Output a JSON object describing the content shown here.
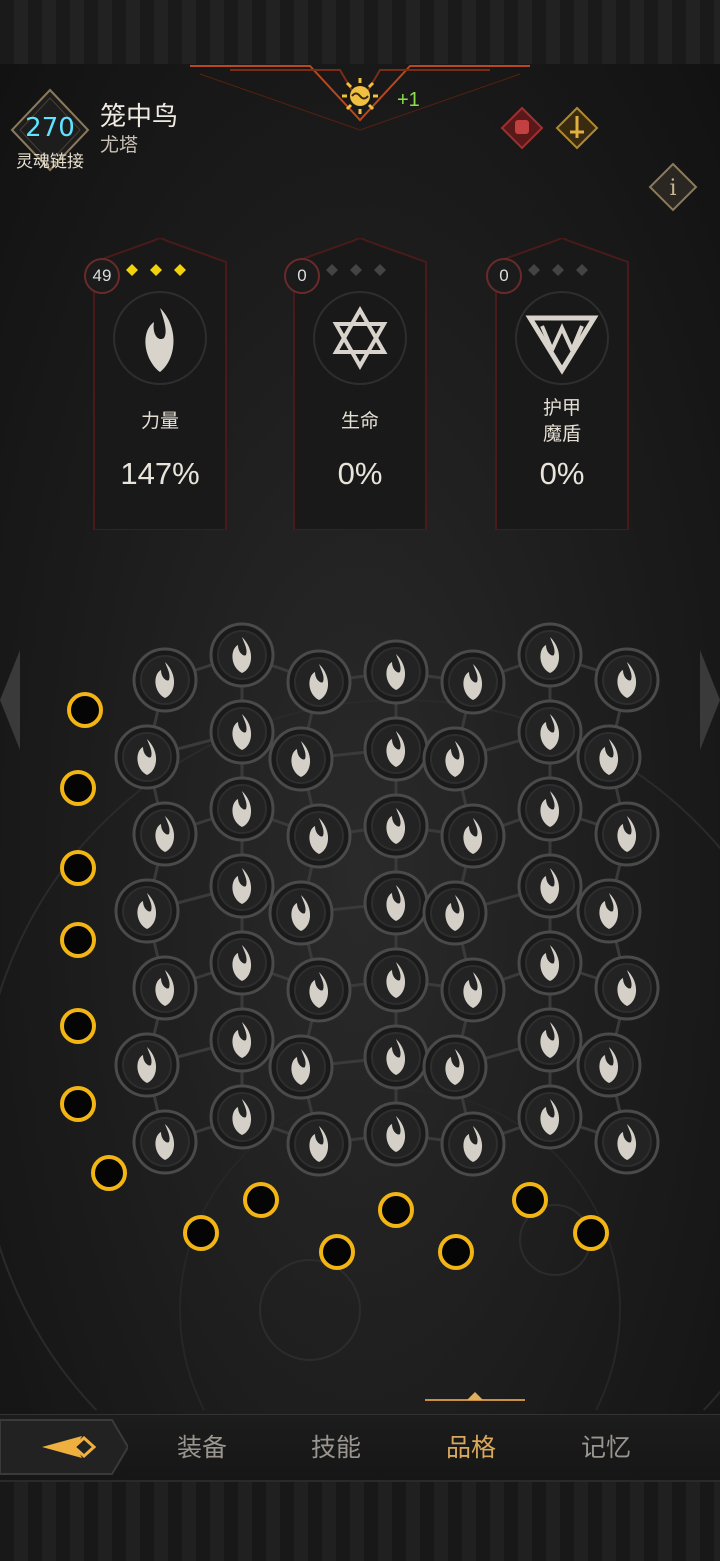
{
  "soul_link": {
    "count": "270",
    "label": "灵魂链接"
  },
  "character": {
    "name": "笼中鸟",
    "class": "尤塔"
  },
  "bonus": {
    "text": "+1"
  },
  "attributes": [
    {
      "rank": "49",
      "label": "力量",
      "value": "147%",
      "icon": "flame-icon",
      "diamonds_filled": 3
    },
    {
      "rank": "0",
      "label": "生命",
      "value": "0%",
      "icon": "hexagram-icon",
      "diamonds_filled": 0
    },
    {
      "rank": "0",
      "label": "护甲\n魔盾",
      "label_line1": "护甲",
      "label_line2": "魔盾",
      "value": "0%",
      "icon": "triangle-shield-icon",
      "diamonds_filled": 0
    }
  ],
  "nav": {
    "tab1": "装备",
    "tab2": "技能",
    "tab3": "品格",
    "tab4": "记忆",
    "active": "品格"
  },
  "colors": {
    "accent_gold": "#d9a85c",
    "node_ring": "#f2b514",
    "soul_count": "#5fe3ff",
    "bonus_green": "#8be04a",
    "diamond": "#f2d20c"
  }
}
